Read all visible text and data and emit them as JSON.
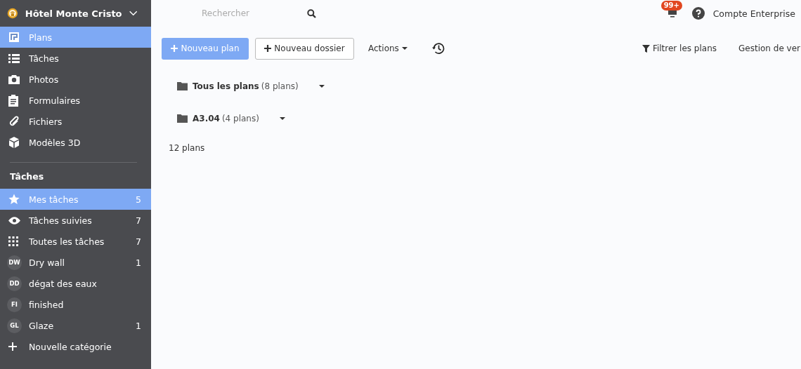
{
  "project": {
    "name": "Hôtel Monte Cristo"
  },
  "nav": [
    {
      "label": "Plans",
      "selected": true
    },
    {
      "label": "Tâches",
      "selected": false
    },
    {
      "label": "Photos",
      "selected": false
    },
    {
      "label": "Formulaires",
      "selected": false
    },
    {
      "label": "Fichiers",
      "selected": false
    },
    {
      "label": "Modèles 3D",
      "selected": false
    }
  ],
  "tasks_heading": "Tâches",
  "task_lists": [
    {
      "kind": "icon",
      "label": "Mes tâches",
      "count": "5",
      "selected": true
    },
    {
      "kind": "icon",
      "label": "Tâches suivies",
      "count": "7",
      "selected": false
    },
    {
      "kind": "icon",
      "label": "Toutes les tâches",
      "count": "7",
      "selected": false
    },
    {
      "kind": "avatar",
      "initials": "DW",
      "label": "Dry wall",
      "count": "1",
      "selected": false
    },
    {
      "kind": "avatar",
      "initials": "DD",
      "label": "dégat des eaux",
      "selected": false
    },
    {
      "kind": "avatar",
      "initials": "FI",
      "label": "finished",
      "selected": false
    },
    {
      "kind": "avatar",
      "initials": "GL",
      "label": "Glaze",
      "count": "1",
      "selected": false
    },
    {
      "kind": "add",
      "label": "Nouvelle catégorie",
      "selected": false
    }
  ],
  "search": {
    "placeholder": "Rechercher"
  },
  "notifications": {
    "badge": "99+"
  },
  "account": "Compte Enterprise",
  "toolbar": {
    "new_plan": "Nouveau plan",
    "new_folder": "Nouveau dossier",
    "actions": "Actions",
    "filter": "Filtrer les plans",
    "versions": "Gestion de ver"
  },
  "folders": [
    {
      "name": "Tous les plans",
      "count": "(8 plans)"
    },
    {
      "name": "A3.04",
      "count": "(4 plans)"
    }
  ],
  "total": "12 plans"
}
